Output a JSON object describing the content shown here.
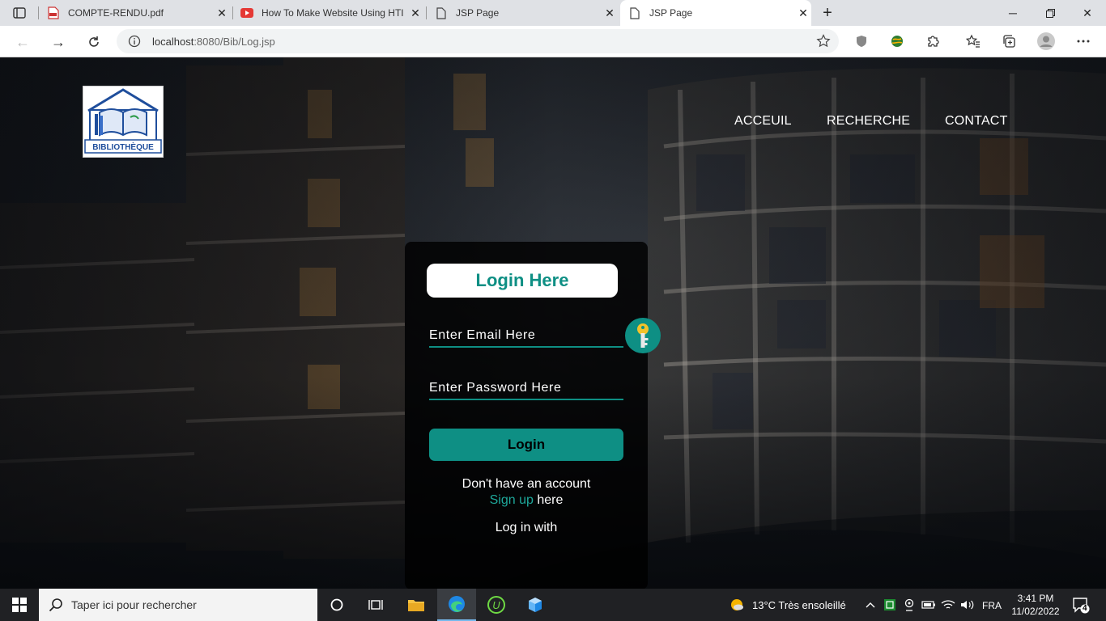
{
  "browser": {
    "tabs": [
      {
        "title": "COMPTE-RENDU.pdf",
        "icon": "pdf-icon"
      },
      {
        "title": "How To Make Website Using HTI",
        "icon": "youtube-icon"
      },
      {
        "title": "JSP Page",
        "icon": "page-icon"
      },
      {
        "title": "JSP Page",
        "icon": "page-icon",
        "active": true
      }
    ],
    "address": {
      "host": "localhost",
      "path": ":8080/Bib/Log.jsp"
    }
  },
  "site": {
    "logo_text": "BIBLIOTHÈQUE",
    "nav": [
      "ACCEUIL",
      "RECHERCHE",
      "CONTACT"
    ],
    "login": {
      "title": "Login Here",
      "email_placeholder": "Enter Email Here",
      "password_placeholder": "Enter Password Here",
      "button": "Login",
      "no_account": "Don't have an account",
      "signup_link": "Sign up",
      "signup_suffix": " here",
      "login_with": "Log in with"
    },
    "accent_color": "#0e8f84"
  },
  "taskbar": {
    "search_placeholder": "Taper ici pour rechercher",
    "weather": "13°C  Très ensoleillé",
    "language": "FRA",
    "time": "3:41 PM",
    "date": "11/02/2022",
    "notifications": "4"
  }
}
